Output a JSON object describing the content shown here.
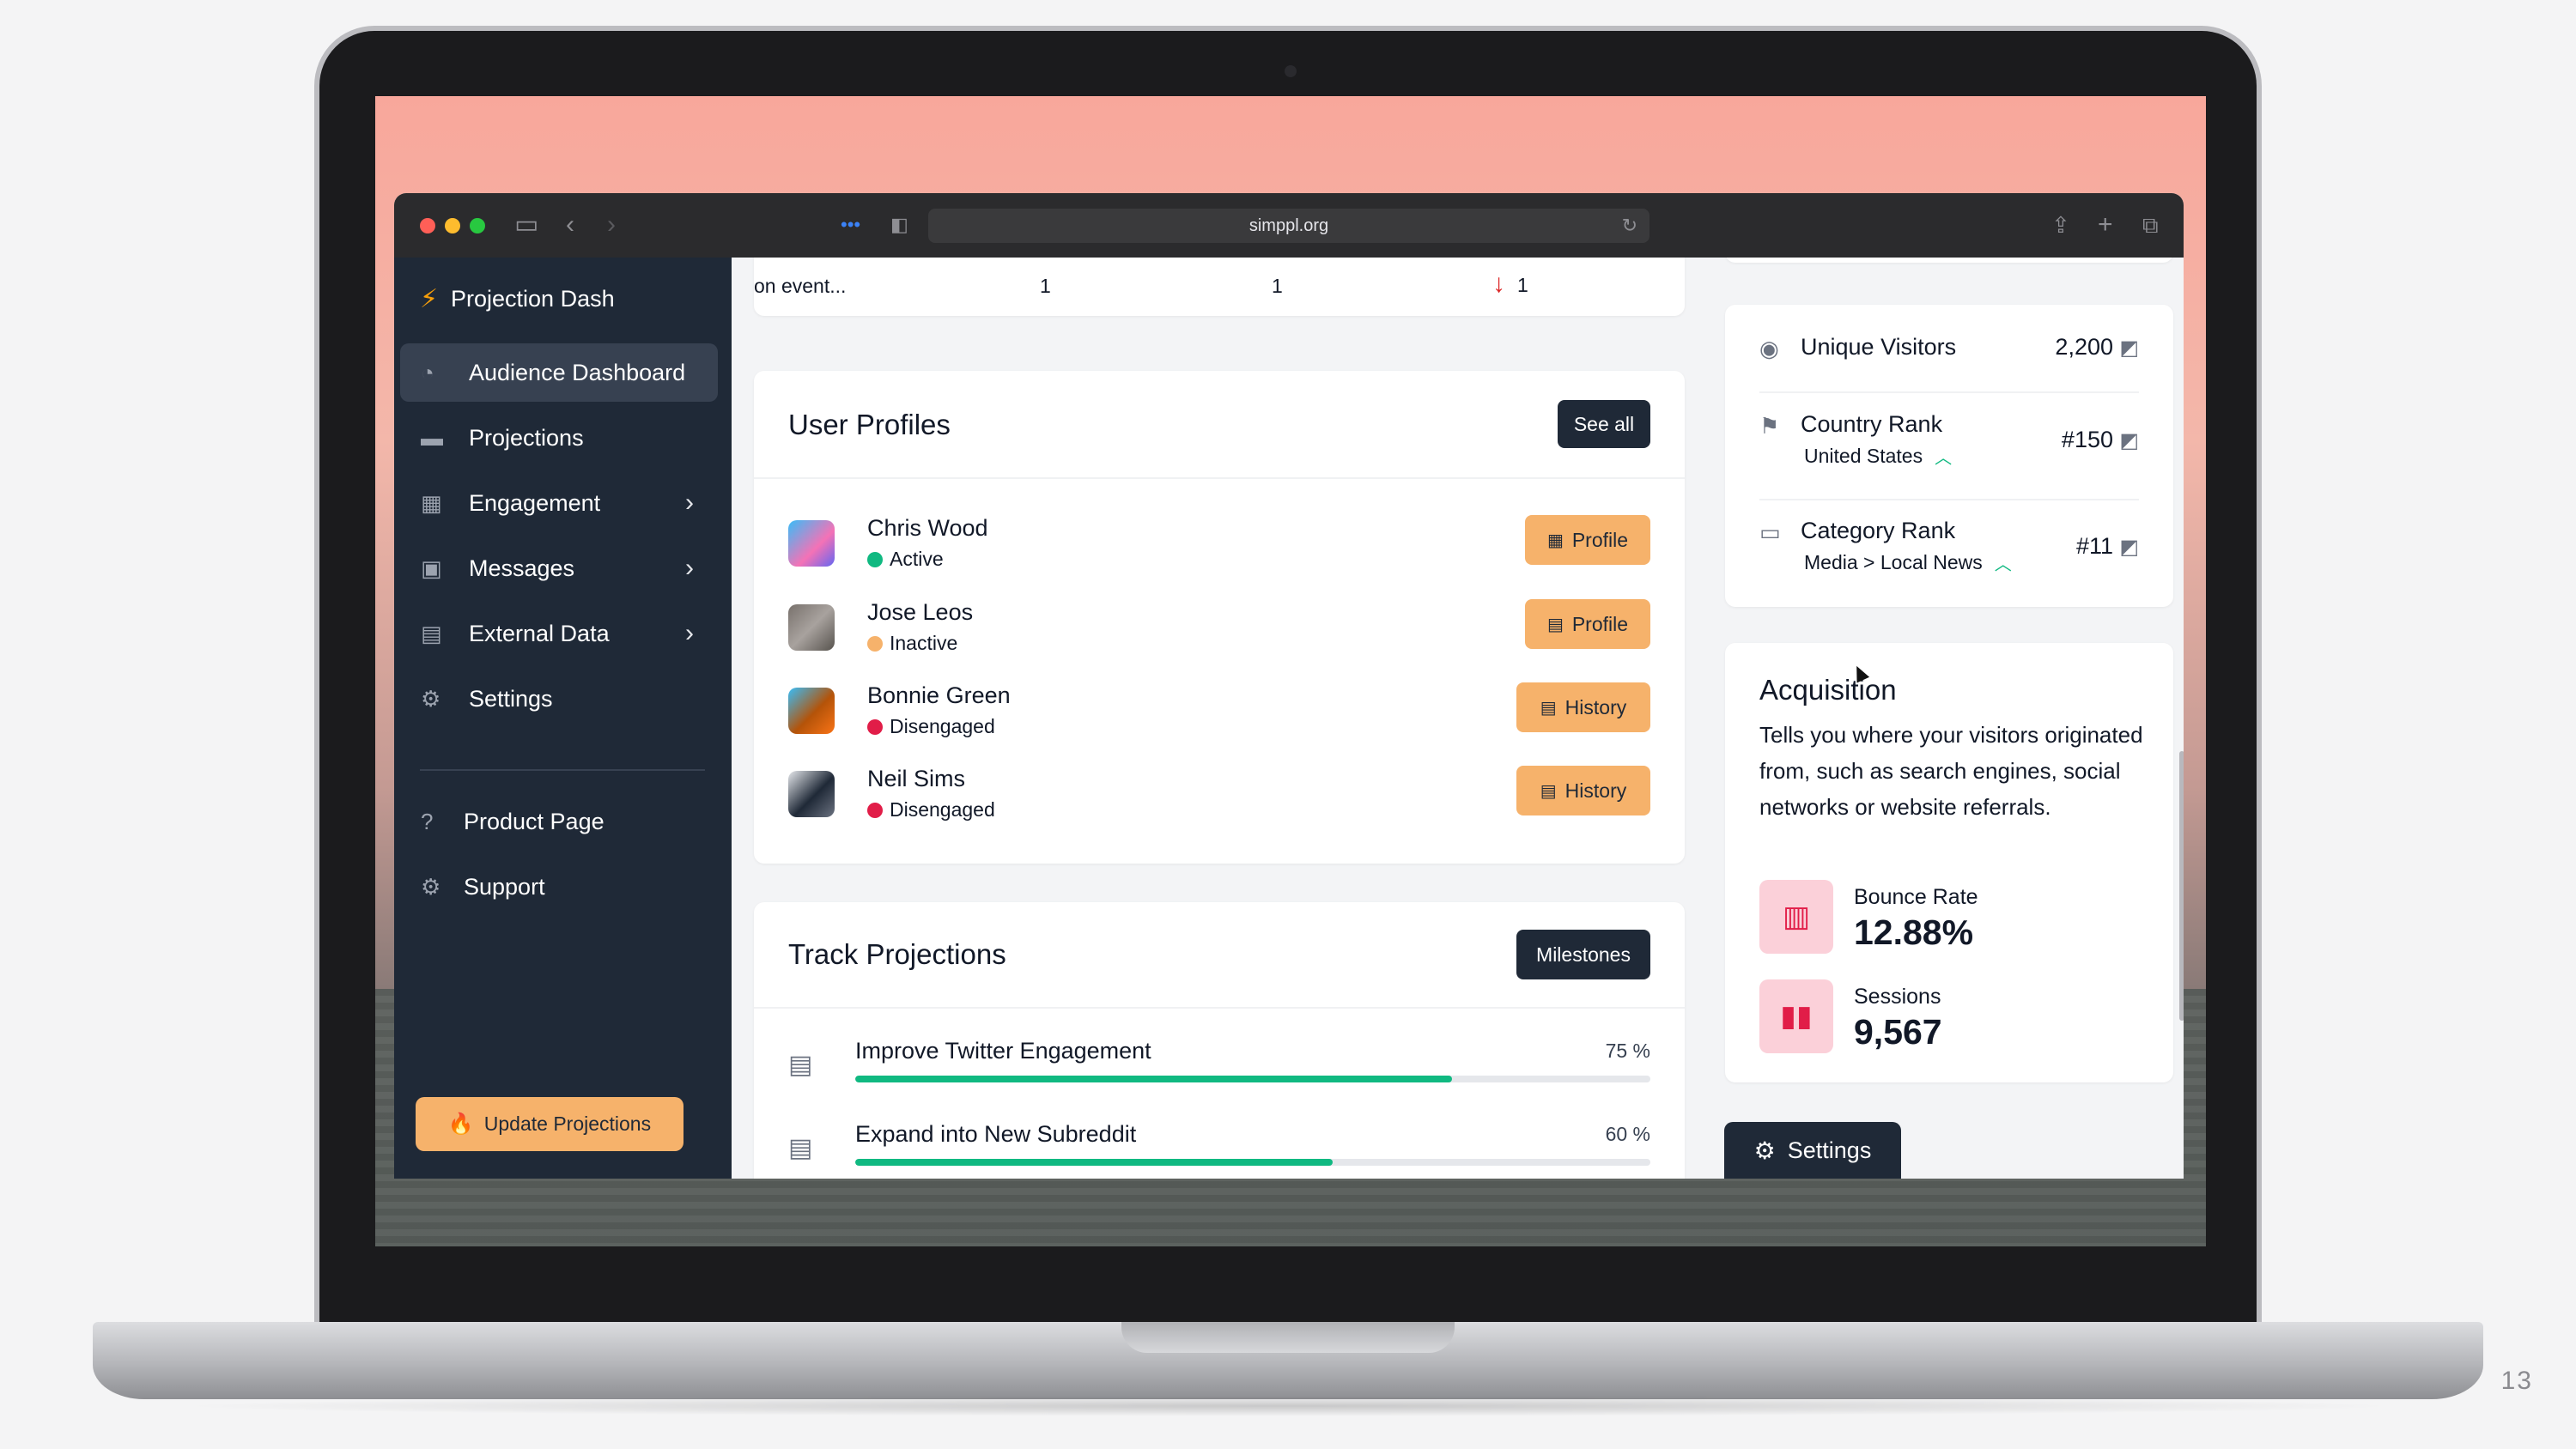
{
  "browser": {
    "url": "simppl.org"
  },
  "sidebar": {
    "brand": "Projection Dash",
    "items": [
      {
        "label": "Audience Dashboard",
        "icon": "pie-chart-icon",
        "active": true
      },
      {
        "label": "Projections",
        "icon": "card-icon",
        "active": false
      },
      {
        "label": "Engagement",
        "icon": "table-icon",
        "active": false,
        "has_submenu": true
      },
      {
        "label": "Messages",
        "icon": "inbox-icon",
        "active": false,
        "has_submenu": true
      },
      {
        "label": "External Data",
        "icon": "archive-icon",
        "active": false,
        "has_submenu": true
      },
      {
        "label": "Settings",
        "icon": "gear-icon",
        "active": false
      }
    ],
    "secondary_items": [
      {
        "label": "Product Page",
        "icon": "question-circle-icon"
      },
      {
        "label": "Support",
        "icon": "gear-icon"
      }
    ],
    "update_button": "Update Projections"
  },
  "top_row": {
    "name": "on event...",
    "col1": "1",
    "col2": "1",
    "col3": "1",
    "trend": "down"
  },
  "user_profiles": {
    "title": "User Profiles",
    "see_all": "See all",
    "users": [
      {
        "name": "Chris Wood",
        "status": "Active",
        "status_color": "#10b981",
        "action": "Profile"
      },
      {
        "name": "Jose Leos",
        "status": "Inactive",
        "status_color": "#f6b26b",
        "action": "Profile"
      },
      {
        "name": "Bonnie Green",
        "status": "Disengaged",
        "status_color": "#e11d48",
        "action": "History"
      },
      {
        "name": "Neil Sims",
        "status": "Disengaged",
        "status_color": "#e11d48",
        "action": "History"
      }
    ]
  },
  "track_projections": {
    "title": "Track Projections",
    "milestones_button": "Milestones",
    "tasks": [
      {
        "name": "Improve Twitter Engagement",
        "percent_label": "75 %",
        "progress": 0.75
      },
      {
        "name": "Expand into New Subreddit",
        "percent_label": "60 %",
        "progress": 0.6
      }
    ]
  },
  "stats": {
    "unique_visitors": {
      "label": "Unique Visitors",
      "value": "2,200"
    },
    "country_rank": {
      "label": "Country Rank",
      "sub": "United States",
      "value": "#150"
    },
    "category_rank": {
      "label": "Category Rank",
      "sub": "Media > Local News",
      "value": "#11"
    }
  },
  "acquisition": {
    "title": "Acquisition",
    "description": "Tells you where your visitors originated from, such as search engines, social networks or website referrals.",
    "metrics": [
      {
        "label": "Bounce Rate",
        "value": "12.88%",
        "icon": "presentation-icon"
      },
      {
        "label": "Sessions",
        "value": "9,567",
        "icon": "bar-chart-icon"
      }
    ]
  },
  "settings_button": "Settings",
  "slide_number": "13",
  "colors": {
    "sidebar_bg": "#1f2937",
    "accent_orange": "#f6b26b",
    "progress_green": "#10b981",
    "metric_red": "#e11d48"
  }
}
